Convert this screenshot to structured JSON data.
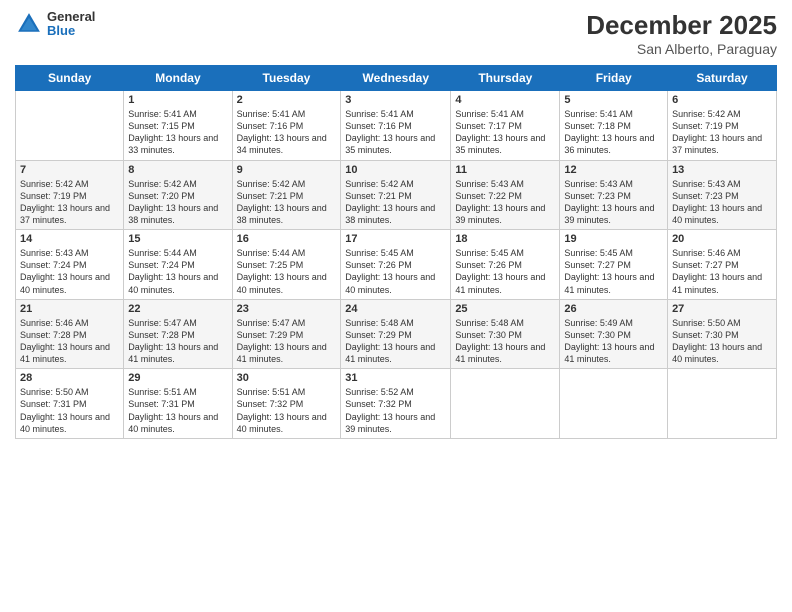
{
  "header": {
    "logo": {
      "general": "General",
      "blue": "Blue"
    },
    "title": "December 2025",
    "subtitle": "San Alberto, Paraguay"
  },
  "days_of_week": [
    "Sunday",
    "Monday",
    "Tuesday",
    "Wednesday",
    "Thursday",
    "Friday",
    "Saturday"
  ],
  "weeks": [
    [
      {
        "day": "",
        "sunrise": "",
        "sunset": "",
        "daylight": ""
      },
      {
        "day": "1",
        "sunrise": "Sunrise: 5:41 AM",
        "sunset": "Sunset: 7:15 PM",
        "daylight": "Daylight: 13 hours and 33 minutes."
      },
      {
        "day": "2",
        "sunrise": "Sunrise: 5:41 AM",
        "sunset": "Sunset: 7:16 PM",
        "daylight": "Daylight: 13 hours and 34 minutes."
      },
      {
        "day": "3",
        "sunrise": "Sunrise: 5:41 AM",
        "sunset": "Sunset: 7:16 PM",
        "daylight": "Daylight: 13 hours and 35 minutes."
      },
      {
        "day": "4",
        "sunrise": "Sunrise: 5:41 AM",
        "sunset": "Sunset: 7:17 PM",
        "daylight": "Daylight: 13 hours and 35 minutes."
      },
      {
        "day": "5",
        "sunrise": "Sunrise: 5:41 AM",
        "sunset": "Sunset: 7:18 PM",
        "daylight": "Daylight: 13 hours and 36 minutes."
      },
      {
        "day": "6",
        "sunrise": "Sunrise: 5:42 AM",
        "sunset": "Sunset: 7:19 PM",
        "daylight": "Daylight: 13 hours and 37 minutes."
      }
    ],
    [
      {
        "day": "7",
        "sunrise": "Sunrise: 5:42 AM",
        "sunset": "Sunset: 7:19 PM",
        "daylight": "Daylight: 13 hours and 37 minutes."
      },
      {
        "day": "8",
        "sunrise": "Sunrise: 5:42 AM",
        "sunset": "Sunset: 7:20 PM",
        "daylight": "Daylight: 13 hours and 38 minutes."
      },
      {
        "day": "9",
        "sunrise": "Sunrise: 5:42 AM",
        "sunset": "Sunset: 7:21 PM",
        "daylight": "Daylight: 13 hours and 38 minutes."
      },
      {
        "day": "10",
        "sunrise": "Sunrise: 5:42 AM",
        "sunset": "Sunset: 7:21 PM",
        "daylight": "Daylight: 13 hours and 38 minutes."
      },
      {
        "day": "11",
        "sunrise": "Sunrise: 5:43 AM",
        "sunset": "Sunset: 7:22 PM",
        "daylight": "Daylight: 13 hours and 39 minutes."
      },
      {
        "day": "12",
        "sunrise": "Sunrise: 5:43 AM",
        "sunset": "Sunset: 7:23 PM",
        "daylight": "Daylight: 13 hours and 39 minutes."
      },
      {
        "day": "13",
        "sunrise": "Sunrise: 5:43 AM",
        "sunset": "Sunset: 7:23 PM",
        "daylight": "Daylight: 13 hours and 40 minutes."
      }
    ],
    [
      {
        "day": "14",
        "sunrise": "Sunrise: 5:43 AM",
        "sunset": "Sunset: 7:24 PM",
        "daylight": "Daylight: 13 hours and 40 minutes."
      },
      {
        "day": "15",
        "sunrise": "Sunrise: 5:44 AM",
        "sunset": "Sunset: 7:24 PM",
        "daylight": "Daylight: 13 hours and 40 minutes."
      },
      {
        "day": "16",
        "sunrise": "Sunrise: 5:44 AM",
        "sunset": "Sunset: 7:25 PM",
        "daylight": "Daylight: 13 hours and 40 minutes."
      },
      {
        "day": "17",
        "sunrise": "Sunrise: 5:45 AM",
        "sunset": "Sunset: 7:26 PM",
        "daylight": "Daylight: 13 hours and 40 minutes."
      },
      {
        "day": "18",
        "sunrise": "Sunrise: 5:45 AM",
        "sunset": "Sunset: 7:26 PM",
        "daylight": "Daylight: 13 hours and 41 minutes."
      },
      {
        "day": "19",
        "sunrise": "Sunrise: 5:45 AM",
        "sunset": "Sunset: 7:27 PM",
        "daylight": "Daylight: 13 hours and 41 minutes."
      },
      {
        "day": "20",
        "sunrise": "Sunrise: 5:46 AM",
        "sunset": "Sunset: 7:27 PM",
        "daylight": "Daylight: 13 hours and 41 minutes."
      }
    ],
    [
      {
        "day": "21",
        "sunrise": "Sunrise: 5:46 AM",
        "sunset": "Sunset: 7:28 PM",
        "daylight": "Daylight: 13 hours and 41 minutes."
      },
      {
        "day": "22",
        "sunrise": "Sunrise: 5:47 AM",
        "sunset": "Sunset: 7:28 PM",
        "daylight": "Daylight: 13 hours and 41 minutes."
      },
      {
        "day": "23",
        "sunrise": "Sunrise: 5:47 AM",
        "sunset": "Sunset: 7:29 PM",
        "daylight": "Daylight: 13 hours and 41 minutes."
      },
      {
        "day": "24",
        "sunrise": "Sunrise: 5:48 AM",
        "sunset": "Sunset: 7:29 PM",
        "daylight": "Daylight: 13 hours and 41 minutes."
      },
      {
        "day": "25",
        "sunrise": "Sunrise: 5:48 AM",
        "sunset": "Sunset: 7:30 PM",
        "daylight": "Daylight: 13 hours and 41 minutes."
      },
      {
        "day": "26",
        "sunrise": "Sunrise: 5:49 AM",
        "sunset": "Sunset: 7:30 PM",
        "daylight": "Daylight: 13 hours and 41 minutes."
      },
      {
        "day": "27",
        "sunrise": "Sunrise: 5:50 AM",
        "sunset": "Sunset: 7:30 PM",
        "daylight": "Daylight: 13 hours and 40 minutes."
      }
    ],
    [
      {
        "day": "28",
        "sunrise": "Sunrise: 5:50 AM",
        "sunset": "Sunset: 7:31 PM",
        "daylight": "Daylight: 13 hours and 40 minutes."
      },
      {
        "day": "29",
        "sunrise": "Sunrise: 5:51 AM",
        "sunset": "Sunset: 7:31 PM",
        "daylight": "Daylight: 13 hours and 40 minutes."
      },
      {
        "day": "30",
        "sunrise": "Sunrise: 5:51 AM",
        "sunset": "Sunset: 7:32 PM",
        "daylight": "Daylight: 13 hours and 40 minutes."
      },
      {
        "day": "31",
        "sunrise": "Sunrise: 5:52 AM",
        "sunset": "Sunset: 7:32 PM",
        "daylight": "Daylight: 13 hours and 39 minutes."
      },
      {
        "day": "",
        "sunrise": "",
        "sunset": "",
        "daylight": ""
      },
      {
        "day": "",
        "sunrise": "",
        "sunset": "",
        "daylight": ""
      },
      {
        "day": "",
        "sunrise": "",
        "sunset": "",
        "daylight": ""
      }
    ]
  ]
}
